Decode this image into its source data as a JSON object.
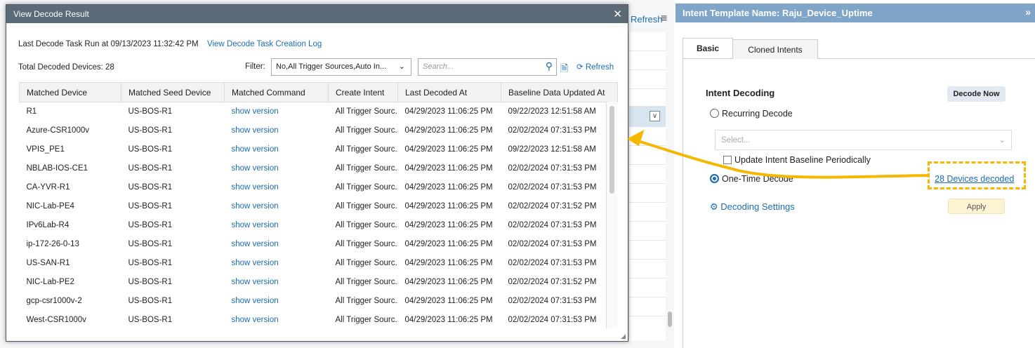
{
  "background": {
    "refresh_label": "Refresh",
    "menu_icon": "hamburger-icon"
  },
  "panel": {
    "title": "Intent Template Name: Raju_Device_Uptime",
    "tabs": [
      "Basic",
      "Cloned Intents"
    ],
    "section_title": "Intent Decoding",
    "decode_now": "Decode Now",
    "recurring_label": "Recurring Decode",
    "select_placeholder": "Select...",
    "update_baseline_label": "Update Intent Baseline Periodically",
    "one_time_label": "One-Time Decode",
    "devices_decoded_link": "28 Devices decoded",
    "decoding_settings": "Decoding Settings",
    "apply": "Apply",
    "selected_mode": "One-Time Decode",
    "update_baseline_checked": false
  },
  "modal": {
    "title": "View Decode Result",
    "last_run": "Last Decode Task Run at 09/13/2023 11:32:42 PM",
    "log_link": "View Decode Task Creation Log",
    "total": "Total Decoded Devices: 28",
    "filter_label": "Filter:",
    "filter_value": "No,All Trigger Sources,Auto In...",
    "search_placeholder": "Search...",
    "refresh_label": "Refresh",
    "columns": [
      "Matched Device",
      "Matched Seed Device",
      "Matched Command",
      "Create Intent",
      "Last Decoded At",
      "Baseline Data Updated At"
    ],
    "rows": [
      [
        "R1",
        "US-BOS-R1",
        "show version",
        "All Trigger Sourc...",
        "04/29/2023 11:06:25 PM",
        "09/22/2023 12:51:58 AM"
      ],
      [
        "Azure-CSR1000v",
        "US-BOS-R1",
        "show version",
        "All Trigger Sourc...",
        "04/29/2023 11:06:25 PM",
        "02/02/2024 07:31:53 PM"
      ],
      [
        "VPIS_PE1",
        "US-BOS-R1",
        "show version",
        "All Trigger Sourc...",
        "04/29/2023 11:06:25 PM",
        "09/22/2023 12:51:58 AM"
      ],
      [
        "NBLAB-IOS-CE1",
        "US-BOS-R1",
        "show version",
        "All Trigger Sourc...",
        "04/29/2023 11:06:25 PM",
        "02/02/2024 07:31:53 PM"
      ],
      [
        "CA-YVR-R1",
        "US-BOS-R1",
        "show version",
        "All Trigger Sourc...",
        "04/29/2023 11:06:25 PM",
        "02/02/2024 07:31:53 PM"
      ],
      [
        "NIC-Lab-PE4",
        "US-BOS-R1",
        "show version",
        "All Trigger Sourc...",
        "04/29/2023 11:06:25 PM",
        "02/02/2024 07:31:52 PM"
      ],
      [
        "IPv6Lab-R4",
        "US-BOS-R1",
        "show version",
        "All Trigger Sourc...",
        "04/29/2023 11:06:25 PM",
        "02/02/2024 07:31:53 PM"
      ],
      [
        "ip-172-26-0-13",
        "US-BOS-R1",
        "show version",
        "All Trigger Sourc...",
        "04/29/2023 11:06:25 PM",
        "02/02/2024 07:31:53 PM"
      ],
      [
        "US-SAN-R1",
        "US-BOS-R1",
        "show version",
        "All Trigger Sourc...",
        "04/29/2023 11:06:25 PM",
        "02/02/2024 07:31:53 PM"
      ],
      [
        "NIC-Lab-PE2",
        "US-BOS-R1",
        "show version",
        "All Trigger Sourc...",
        "04/29/2023 11:06:25 PM",
        "02/02/2024 07:31:52 PM"
      ],
      [
        "gcp-csr1000v-2",
        "US-BOS-R1",
        "show version",
        "All Trigger Sourc...",
        "04/29/2023 11:06:25 PM",
        "02/02/2024 07:31:53 PM"
      ],
      [
        "West-CSR1000v",
        "US-BOS-R1",
        "show version",
        "All Trigger Sourc...",
        "04/29/2023 11:06:25 PM",
        "02/02/2024 07:31:53 PM"
      ]
    ]
  },
  "annotation_color": "#f5b800"
}
